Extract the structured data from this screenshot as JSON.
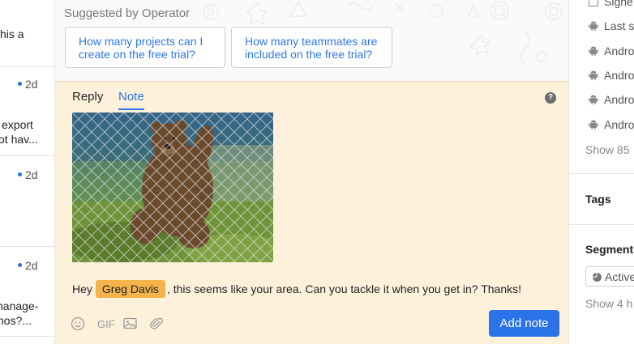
{
  "left_list": [
    {
      "text": "his a",
      "time": ""
    },
    {
      "text": "",
      "time": "2d"
    },
    {
      "text": "export",
      "time": ""
    },
    {
      "text": "ot hav...",
      "time": ""
    },
    {
      "text": "",
      "time": "2d"
    },
    {
      "text": "",
      "time": "2d"
    },
    {
      "text": "nanage-",
      "time": ""
    },
    {
      "text": "nos?...",
      "time": ""
    }
  ],
  "suggestions": {
    "title": "Suggested by Operator",
    "items": [
      {
        "line1": "How many projects can I",
        "line2": "create on the free trial?"
      },
      {
        "line1": "How many teammates are",
        "line2": "included on the free trial?"
      }
    ]
  },
  "composer": {
    "tabs": {
      "reply": "Reply",
      "note": "Note"
    },
    "help_icon": "?",
    "note_prefix": "Hey",
    "mention": "Greg Davis",
    "note_suffix": ", this seems like your area. Can you tackle it when you get in? Thanks!",
    "tools": {
      "gif": "GIF"
    },
    "add_note_label": "Add note"
  },
  "sidebar": {
    "top_partial": "Signe",
    "last_seen": "Last s",
    "devices": [
      "Andro",
      "Andro",
      "Andro",
      "Andro"
    ],
    "show_more": "Show 85",
    "tags_title": "Tags",
    "segments_title": "Segments",
    "segment_active": "Active",
    "segments_show": "Show 4 h"
  },
  "colors": {
    "accent": "#2b73e8",
    "composer_bg": "#fdf1dc",
    "mention_bg": "#f5b44b"
  }
}
